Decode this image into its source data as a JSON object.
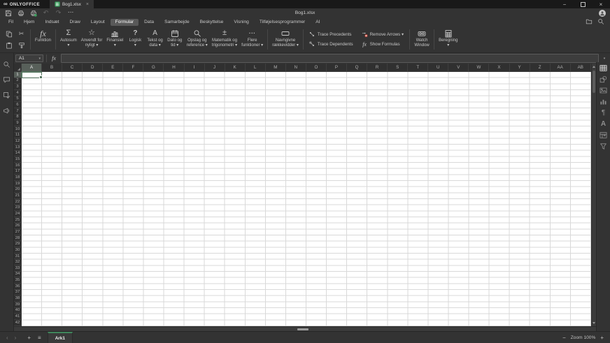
{
  "titlebar": {
    "app_name": "ONLYOFFICE",
    "logo_glyph": "∞",
    "doc_tab": {
      "label": "Bog1.xlsx",
      "close_glyph": "×"
    },
    "window_controls": {
      "minimize": "−",
      "close": "×"
    }
  },
  "toolbar": {
    "title": "Bog1.xlsx",
    "quick_access": [
      {
        "name": "save",
        "enabled": true
      },
      {
        "name": "print",
        "enabled": true
      },
      {
        "name": "quick-print",
        "enabled": true
      },
      {
        "name": "undo",
        "enabled": false
      },
      {
        "name": "redo",
        "enabled": false
      },
      {
        "name": "more",
        "enabled": true
      }
    ]
  },
  "menu": {
    "tabs": [
      {
        "label": "Fil"
      },
      {
        "label": "Hjem"
      },
      {
        "label": "Indsæt"
      },
      {
        "label": "Draw"
      },
      {
        "label": "Layout"
      },
      {
        "label": "Formular",
        "active": true
      },
      {
        "label": "Data"
      },
      {
        "label": "Samarbejde"
      },
      {
        "label": "Beskyttelse"
      },
      {
        "label": "Visning"
      },
      {
        "label": "Tilføjelsesprogrammer"
      },
      {
        "label": "AI"
      }
    ],
    "right_icons": [
      {
        "name": "open-location"
      },
      {
        "name": "search"
      }
    ]
  },
  "ribbon": {
    "clipboard": [
      {
        "name": "copy"
      },
      {
        "name": "cut"
      },
      {
        "name": "paste"
      },
      {
        "name": "copy-style"
      }
    ],
    "groups": [
      {
        "id": "function",
        "buttons": [
          {
            "icon": "fx",
            "lines": [
              "Funktion"
            ]
          }
        ]
      },
      {
        "id": "library",
        "buttons": [
          {
            "icon": "sigma",
            "lines": [
              "Autosum",
              "▾"
            ]
          },
          {
            "icon": "star",
            "lines": [
              "Anvendt for",
              "nyligt ▾"
            ]
          },
          {
            "icon": "finance",
            "lines": [
              "Finansiel",
              "▾"
            ]
          },
          {
            "icon": "question",
            "lines": [
              "Logisk",
              "▾"
            ]
          },
          {
            "icon": "text",
            "lines": [
              "Tekst og",
              "data ▾"
            ]
          },
          {
            "icon": "calendar",
            "lines": [
              "Dato og",
              "tid ▾"
            ]
          },
          {
            "icon": "lookup",
            "lines": [
              "Opslag og",
              "reference ▾"
            ]
          },
          {
            "icon": "math",
            "lines": [
              "Matematik og",
              "trigonometri ▾"
            ]
          },
          {
            "icon": "more-functions",
            "lines": [
              "Flere",
              "funktioner ▾"
            ]
          }
        ]
      },
      {
        "id": "named-ranges",
        "buttons": [
          {
            "icon": "named-range",
            "lines": [
              "Navngivne",
              "rækkevidder ▾"
            ]
          }
        ]
      },
      {
        "id": "trace",
        "small_buttons": [
          {
            "icon": "trace-precedents",
            "label": "Trace Precedents"
          },
          {
            "icon": "remove-arrows",
            "label": "Remove Arrows",
            "caret": true
          },
          {
            "icon": "trace-dependents",
            "label": "Trace Dependents"
          },
          {
            "icon": "show-formulas",
            "label": "Show Formulas"
          }
        ]
      },
      {
        "id": "watch",
        "buttons": [
          {
            "icon": "watch-window",
            "lines": [
              "Watch",
              "Window"
            ]
          }
        ]
      },
      {
        "id": "calculation",
        "buttons": [
          {
            "icon": "calculation",
            "lines": [
              "Beregning",
              "▾"
            ]
          }
        ]
      }
    ]
  },
  "formula_bar": {
    "name_box": "A1",
    "name_box_caret": "▾",
    "fx": "fx",
    "input_value": "",
    "collapse_glyph": "▾"
  },
  "grid": {
    "columns": [
      "A",
      "B",
      "C",
      "D",
      "E",
      "F",
      "G",
      "H",
      "I",
      "J",
      "K",
      "L",
      "M",
      "N",
      "O",
      "P",
      "Q",
      "R",
      "S",
      "T",
      "U",
      "V",
      "W",
      "X",
      "Y",
      "Z",
      "AA",
      "AB"
    ],
    "rows": [
      "1",
      "2",
      "3",
      "4",
      "5",
      "6",
      "7",
      "8",
      "9",
      "10",
      "11",
      "12",
      "13",
      "14",
      "15",
      "16",
      "17",
      "18",
      "19",
      "20",
      "21",
      "22",
      "23",
      "24",
      "25",
      "26",
      "27",
      "28",
      "29",
      "30",
      "31",
      "32",
      "33",
      "34",
      "35",
      "36",
      "37",
      "38",
      "39",
      "40",
      "41",
      "42"
    ],
    "selected": {
      "cell": "A1",
      "column": "A",
      "row": "1"
    }
  },
  "left_sidebar": [
    {
      "name": "search"
    },
    {
      "name": "comments"
    },
    {
      "name": "spellcheck"
    },
    {
      "name": "feedback"
    }
  ],
  "right_sidebar": [
    {
      "name": "cell-settings",
      "active": true
    },
    {
      "name": "shape-settings"
    },
    {
      "name": "image-settings"
    },
    {
      "name": "chart-settings"
    },
    {
      "name": "paragraph-settings"
    },
    {
      "name": "textart-settings"
    },
    {
      "name": "pivot-settings"
    },
    {
      "name": "slicer-settings"
    }
  ],
  "statusbar": {
    "prev_sheet": "‹",
    "next_sheet": "›",
    "add_sheet": "+",
    "sheet_list": "≡",
    "sheet_tabs": [
      {
        "label": "Ark1",
        "active": true
      }
    ],
    "zoom_out": "−",
    "zoom_label": "Zoom 100%",
    "zoom_in": "+"
  },
  "colors": {
    "titlebar_bg": "#191919",
    "chrome_bg": "#333333",
    "active_tab_pill": "#595959",
    "accent_green": "#40865c",
    "selection_border": "#567560",
    "header_bg": "#303030",
    "grid_line": "#d9d9d9",
    "sheet_icon_green": "#3da05f",
    "remove_arrows_red": "#c0392b"
  }
}
